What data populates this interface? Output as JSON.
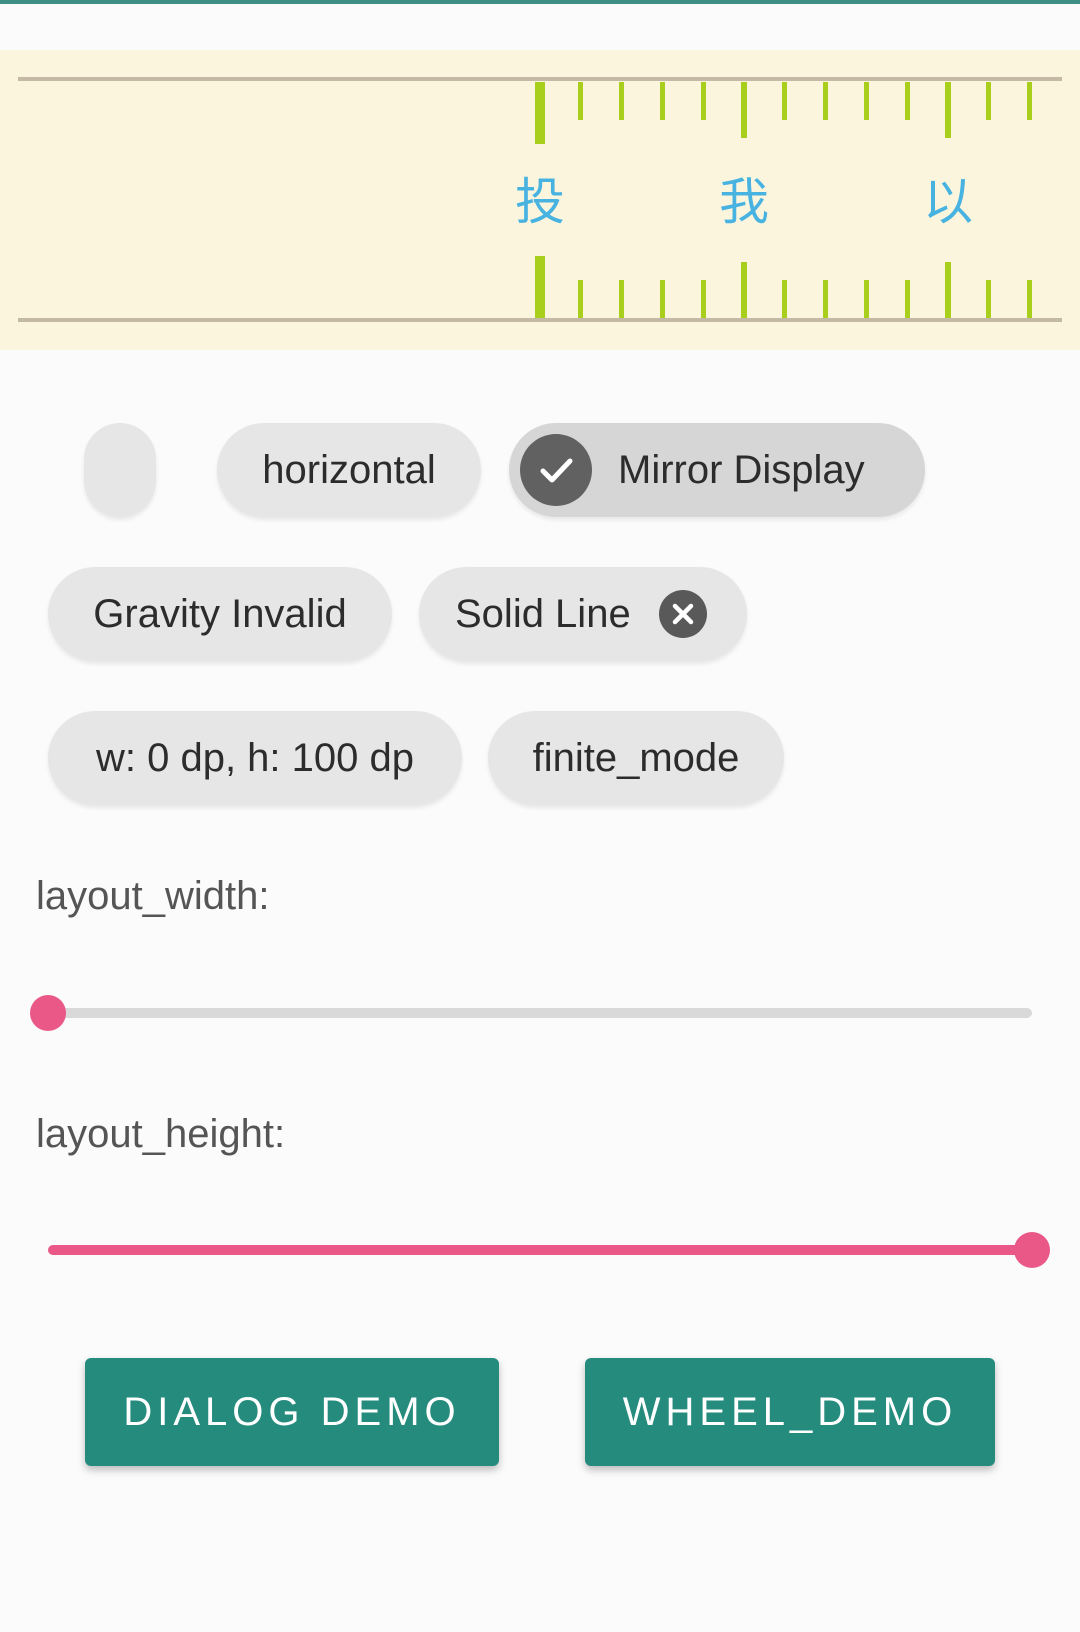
{
  "ruler": {
    "labels": [
      "投",
      "我",
      "以"
    ],
    "tick_color": "#a8cf1b",
    "label_color": "#48b3e0",
    "background": "#fbf5de"
  },
  "chips": {
    "empty": "",
    "horizontal": "horizontal",
    "mirror_display": "Mirror Display",
    "gravity_invalid": "Gravity Invalid",
    "solid_line": "Solid Line",
    "size": "w: 0 dp, h: 100 dp",
    "finite_mode": "finite_mode"
  },
  "sliders": {
    "width_label": "layout_width:",
    "width_value": 0.0,
    "height_label": "layout_height:",
    "height_value": 1.0,
    "accent": "#ea5888"
  },
  "buttons": {
    "dialog_demo": "DIALOG DEMO",
    "wheel_demo": "WHEEL_DEMO",
    "color": "#258b7d"
  }
}
